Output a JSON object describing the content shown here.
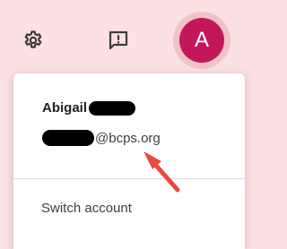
{
  "topbar": {
    "settings_icon": "gear-icon",
    "feedback_icon": "feedback-icon",
    "avatar_initial": "A",
    "avatar_color": "#c2185b"
  },
  "account_menu": {
    "name_visible": "Abigail",
    "email_visible": "@bcps.org",
    "switch_account_label": "Switch account"
  },
  "annotation": {
    "color": "#e84a3e"
  }
}
